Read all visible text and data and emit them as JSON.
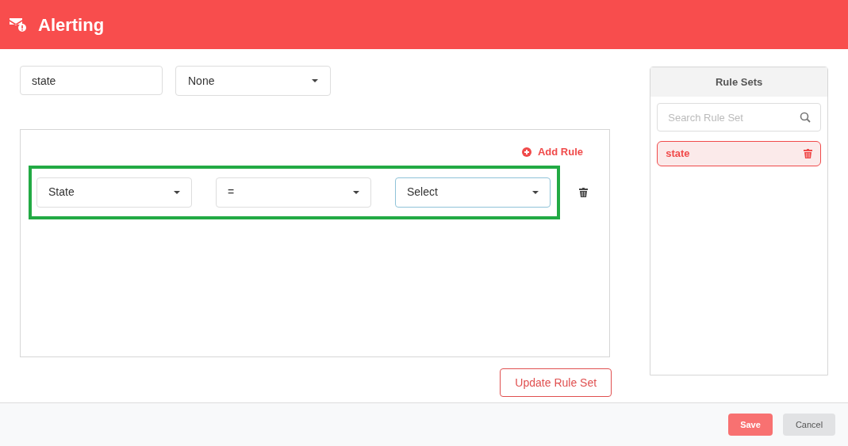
{
  "header": {
    "title": "Alerting"
  },
  "name_field": {
    "value": "state"
  },
  "type_select": {
    "value": "None"
  },
  "add_rule": {
    "label": "Add Rule"
  },
  "rules": [
    {
      "highlighted": true,
      "fields": [
        {
          "value": "State",
          "focused": false
        },
        {
          "value": "=",
          "focused": false
        },
        {
          "value": "Select",
          "focused": true
        }
      ]
    }
  ],
  "update_button": {
    "label": "Update Rule Set"
  },
  "rule_sets": {
    "title": "Rule Sets",
    "search": {
      "placeholder": "Search Rule Set"
    },
    "items": [
      {
        "label": "state",
        "selected": true
      }
    ]
  },
  "footer": {
    "buttons": [
      {
        "label": "Save",
        "kind": "primary"
      },
      {
        "label": "Cancel",
        "kind": "secondary"
      }
    ]
  }
}
